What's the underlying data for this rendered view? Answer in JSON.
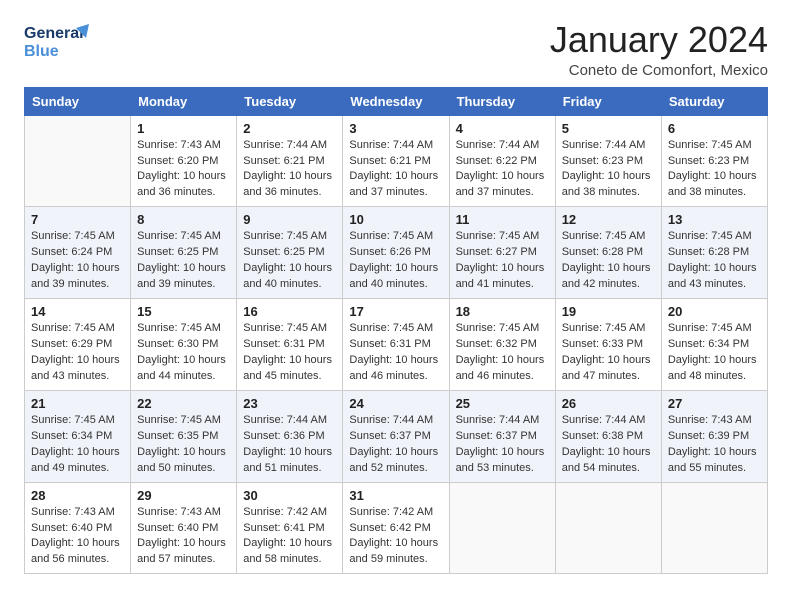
{
  "header": {
    "logo_line1": "General",
    "logo_line2": "Blue",
    "month_title": "January 2024",
    "location": "Coneto de Comonfort, Mexico"
  },
  "weekdays": [
    "Sunday",
    "Monday",
    "Tuesday",
    "Wednesday",
    "Thursday",
    "Friday",
    "Saturday"
  ],
  "weeks": [
    [
      {
        "day": "",
        "sunrise": "",
        "sunset": "",
        "daylight": ""
      },
      {
        "day": "1",
        "sunrise": "Sunrise: 7:43 AM",
        "sunset": "Sunset: 6:20 PM",
        "daylight": "Daylight: 10 hours and 36 minutes."
      },
      {
        "day": "2",
        "sunrise": "Sunrise: 7:44 AM",
        "sunset": "Sunset: 6:21 PM",
        "daylight": "Daylight: 10 hours and 36 minutes."
      },
      {
        "day": "3",
        "sunrise": "Sunrise: 7:44 AM",
        "sunset": "Sunset: 6:21 PM",
        "daylight": "Daylight: 10 hours and 37 minutes."
      },
      {
        "day": "4",
        "sunrise": "Sunrise: 7:44 AM",
        "sunset": "Sunset: 6:22 PM",
        "daylight": "Daylight: 10 hours and 37 minutes."
      },
      {
        "day": "5",
        "sunrise": "Sunrise: 7:44 AM",
        "sunset": "Sunset: 6:23 PM",
        "daylight": "Daylight: 10 hours and 38 minutes."
      },
      {
        "day": "6",
        "sunrise": "Sunrise: 7:45 AM",
        "sunset": "Sunset: 6:23 PM",
        "daylight": "Daylight: 10 hours and 38 minutes."
      }
    ],
    [
      {
        "day": "7",
        "sunrise": "Sunrise: 7:45 AM",
        "sunset": "Sunset: 6:24 PM",
        "daylight": "Daylight: 10 hours and 39 minutes."
      },
      {
        "day": "8",
        "sunrise": "Sunrise: 7:45 AM",
        "sunset": "Sunset: 6:25 PM",
        "daylight": "Daylight: 10 hours and 39 minutes."
      },
      {
        "day": "9",
        "sunrise": "Sunrise: 7:45 AM",
        "sunset": "Sunset: 6:25 PM",
        "daylight": "Daylight: 10 hours and 40 minutes."
      },
      {
        "day": "10",
        "sunrise": "Sunrise: 7:45 AM",
        "sunset": "Sunset: 6:26 PM",
        "daylight": "Daylight: 10 hours and 40 minutes."
      },
      {
        "day": "11",
        "sunrise": "Sunrise: 7:45 AM",
        "sunset": "Sunset: 6:27 PM",
        "daylight": "Daylight: 10 hours and 41 minutes."
      },
      {
        "day": "12",
        "sunrise": "Sunrise: 7:45 AM",
        "sunset": "Sunset: 6:28 PM",
        "daylight": "Daylight: 10 hours and 42 minutes."
      },
      {
        "day": "13",
        "sunrise": "Sunrise: 7:45 AM",
        "sunset": "Sunset: 6:28 PM",
        "daylight": "Daylight: 10 hours and 43 minutes."
      }
    ],
    [
      {
        "day": "14",
        "sunrise": "Sunrise: 7:45 AM",
        "sunset": "Sunset: 6:29 PM",
        "daylight": "Daylight: 10 hours and 43 minutes."
      },
      {
        "day": "15",
        "sunrise": "Sunrise: 7:45 AM",
        "sunset": "Sunset: 6:30 PM",
        "daylight": "Daylight: 10 hours and 44 minutes."
      },
      {
        "day": "16",
        "sunrise": "Sunrise: 7:45 AM",
        "sunset": "Sunset: 6:31 PM",
        "daylight": "Daylight: 10 hours and 45 minutes."
      },
      {
        "day": "17",
        "sunrise": "Sunrise: 7:45 AM",
        "sunset": "Sunset: 6:31 PM",
        "daylight": "Daylight: 10 hours and 46 minutes."
      },
      {
        "day": "18",
        "sunrise": "Sunrise: 7:45 AM",
        "sunset": "Sunset: 6:32 PM",
        "daylight": "Daylight: 10 hours and 46 minutes."
      },
      {
        "day": "19",
        "sunrise": "Sunrise: 7:45 AM",
        "sunset": "Sunset: 6:33 PM",
        "daylight": "Daylight: 10 hours and 47 minutes."
      },
      {
        "day": "20",
        "sunrise": "Sunrise: 7:45 AM",
        "sunset": "Sunset: 6:34 PM",
        "daylight": "Daylight: 10 hours and 48 minutes."
      }
    ],
    [
      {
        "day": "21",
        "sunrise": "Sunrise: 7:45 AM",
        "sunset": "Sunset: 6:34 PM",
        "daylight": "Daylight: 10 hours and 49 minutes."
      },
      {
        "day": "22",
        "sunrise": "Sunrise: 7:45 AM",
        "sunset": "Sunset: 6:35 PM",
        "daylight": "Daylight: 10 hours and 50 minutes."
      },
      {
        "day": "23",
        "sunrise": "Sunrise: 7:44 AM",
        "sunset": "Sunset: 6:36 PM",
        "daylight": "Daylight: 10 hours and 51 minutes."
      },
      {
        "day": "24",
        "sunrise": "Sunrise: 7:44 AM",
        "sunset": "Sunset: 6:37 PM",
        "daylight": "Daylight: 10 hours and 52 minutes."
      },
      {
        "day": "25",
        "sunrise": "Sunrise: 7:44 AM",
        "sunset": "Sunset: 6:37 PM",
        "daylight": "Daylight: 10 hours and 53 minutes."
      },
      {
        "day": "26",
        "sunrise": "Sunrise: 7:44 AM",
        "sunset": "Sunset: 6:38 PM",
        "daylight": "Daylight: 10 hours and 54 minutes."
      },
      {
        "day": "27",
        "sunrise": "Sunrise: 7:43 AM",
        "sunset": "Sunset: 6:39 PM",
        "daylight": "Daylight: 10 hours and 55 minutes."
      }
    ],
    [
      {
        "day": "28",
        "sunrise": "Sunrise: 7:43 AM",
        "sunset": "Sunset: 6:40 PM",
        "daylight": "Daylight: 10 hours and 56 minutes."
      },
      {
        "day": "29",
        "sunrise": "Sunrise: 7:43 AM",
        "sunset": "Sunset: 6:40 PM",
        "daylight": "Daylight: 10 hours and 57 minutes."
      },
      {
        "day": "30",
        "sunrise": "Sunrise: 7:42 AM",
        "sunset": "Sunset: 6:41 PM",
        "daylight": "Daylight: 10 hours and 58 minutes."
      },
      {
        "day": "31",
        "sunrise": "Sunrise: 7:42 AM",
        "sunset": "Sunset: 6:42 PM",
        "daylight": "Daylight: 10 hours and 59 minutes."
      },
      {
        "day": "",
        "sunrise": "",
        "sunset": "",
        "daylight": ""
      },
      {
        "day": "",
        "sunrise": "",
        "sunset": "",
        "daylight": ""
      },
      {
        "day": "",
        "sunrise": "",
        "sunset": "",
        "daylight": ""
      }
    ]
  ]
}
